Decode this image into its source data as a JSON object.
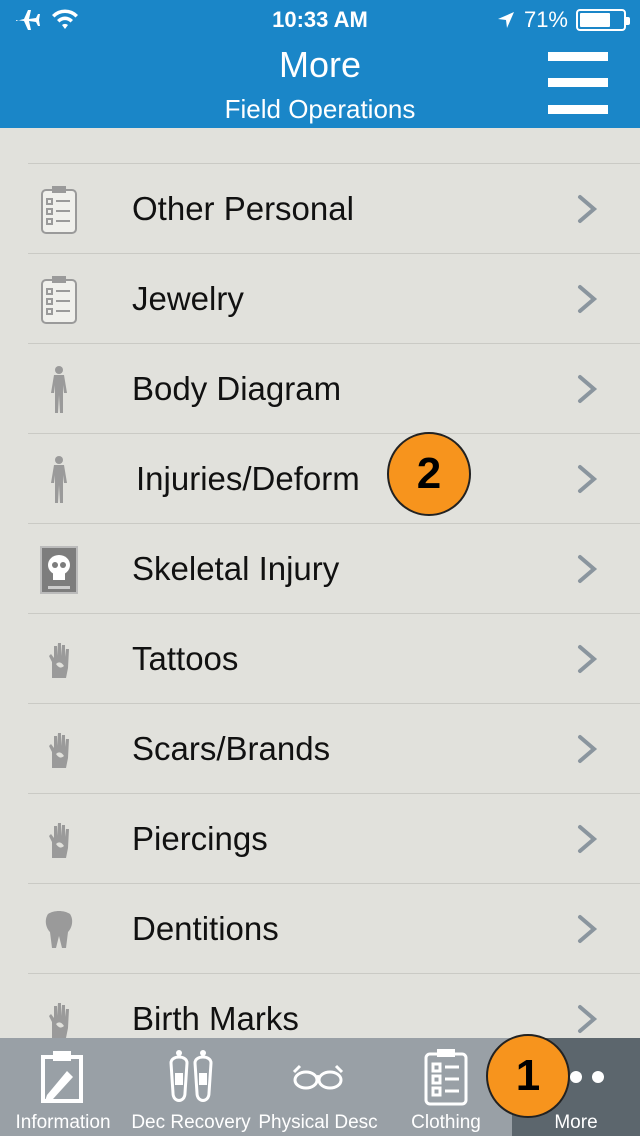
{
  "status": {
    "time": "10:33 AM",
    "battery": "71%",
    "battery_level": 0.71
  },
  "header": {
    "title": "More",
    "subtitle": "Field Operations",
    "menu_icon": "hamburger-icon"
  },
  "list": [
    {
      "label": "Other Personal",
      "icon": "clipboard-icon"
    },
    {
      "label": "Jewelry",
      "icon": "clipboard-icon"
    },
    {
      "label": "Body Diagram",
      "icon": "body-icon"
    },
    {
      "label": "Injuries/Deform",
      "icon": "body-icon"
    },
    {
      "label": "Skeletal Injury",
      "icon": "skull-icon"
    },
    {
      "label": "Tattoos",
      "icon": "hand-icon"
    },
    {
      "label": "Scars/Brands",
      "icon": "hand-icon"
    },
    {
      "label": "Piercings",
      "icon": "hand-icon"
    },
    {
      "label": "Dentitions",
      "icon": "tooth-icon"
    },
    {
      "label": "Birth Marks",
      "icon": "hand-icon"
    }
  ],
  "badges": {
    "one": "1",
    "two": "2"
  },
  "tabs": [
    {
      "label": "Information",
      "icon": "clipboard-pen-icon"
    },
    {
      "label": "Dec Recovery",
      "icon": "feet-icon"
    },
    {
      "label": "Physical Desc",
      "icon": "glasses-icon"
    },
    {
      "label": "Clothing",
      "icon": "checklist-icon"
    },
    {
      "label": "More",
      "icon": "more-dots-icon",
      "active": true
    }
  ],
  "colors": {
    "header": "#1a86c8",
    "background": "#e1e1dc",
    "tabbar": "#99a0a6",
    "tab_active": "#5c666d",
    "badge": "#f7941d"
  }
}
